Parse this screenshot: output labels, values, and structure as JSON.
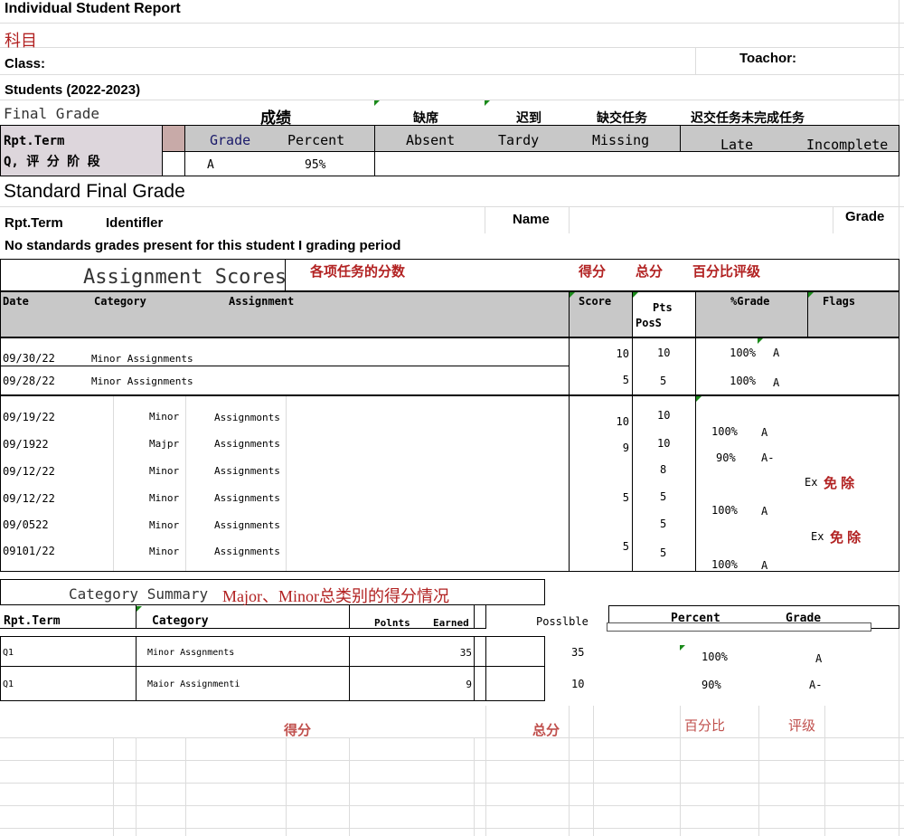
{
  "header": {
    "title": "Individual Student Report",
    "subject_cn": "科目",
    "class_label": "Class:",
    "teacher_label": "Toachor:",
    "students_label": "Students (2022-2023)"
  },
  "final_grade": {
    "label": "Final Grade",
    "label_cn": "成绩",
    "absent_cn": "缺席",
    "tardy_cn": "迟到",
    "missing_cn": "缺交任务",
    "late_incomplete_cn": "迟交任务未完成任务",
    "rpt_term": "Rpt.Term",
    "term_cn": "Q, 评 分 阶 段",
    "col_grade": "Grade",
    "col_percent": "Percent",
    "col_absent": "Absent",
    "col_tardy": "Tardy",
    "col_missing": "Missing",
    "col_late": "Late",
    "col_incomplete": "Incomplete",
    "val_grade": "A",
    "val_percent": "95%"
  },
  "standard": {
    "title": "Standard Final Grade",
    "rpt_term": "Rpt.Term",
    "identifier": "Identifler",
    "name": "Name",
    "grade": "Grade",
    "message": "No standards grades present for this student I grading period"
  },
  "assignments": {
    "title": "Assignment Scores",
    "title_cn": "各项任务的分数",
    "score_cn": "得分",
    "total_cn": "总分",
    "pct_cn": "百分比评级",
    "col_date": "Date",
    "col_category": "Category",
    "col_assignment": "Assignment",
    "col_score": "Score",
    "col_pts": "Pts",
    "col_poss": "PosS",
    "col_pct": "%Grade",
    "col_flags": "Flags",
    "group1": [
      {
        "date": "09/30/22",
        "category": "Minor Assignments",
        "score": "10",
        "pts": "10",
        "pct": "100%",
        "grade": "A"
      },
      {
        "date": "09/28/22",
        "category": "Minor Assignments",
        "score": "5",
        "pts": "5",
        "pct": "100%",
        "grade": "A"
      }
    ],
    "group2": [
      {
        "date": "09/19/22",
        "cat": "Minor",
        "assign": "Assignmonts",
        "score": "10",
        "pts": "10"
      },
      {
        "date": "09/1922",
        "cat": "Majpr",
        "assign": "Assignments",
        "score": "9",
        "pts": "10"
      },
      {
        "date": "09/12/22",
        "cat": "Minor",
        "assign": "Assignments",
        "score": "",
        "pts": "8"
      },
      {
        "date": "09/12/22",
        "cat": "Minor",
        "assign": "Assignments",
        "score": "5",
        "pts": "5"
      },
      {
        "date": "09/0522",
        "cat": "Minor",
        "assign": "Assignments",
        "score": "",
        "pts": "5"
      },
      {
        "date": "09101/22",
        "cat": "Minor",
        "assign": "Assignments",
        "score": "5",
        "pts": "5"
      }
    ],
    "group2_pct": [
      {
        "pct": "100%",
        "grade": "A"
      },
      {
        "pct": "90%",
        "grade": "A-"
      },
      {
        "pct": "100%",
        "grade": "A"
      },
      {
        "pct": "100%",
        "grade": "A"
      }
    ],
    "ex_label": "Ex",
    "exempt_cn": "免 除"
  },
  "summary": {
    "title": "Category Summary",
    "title_cn": "Major、Minor总类别的得分情况",
    "col_rpt": "Rpt.Term",
    "col_category": "Category",
    "col_points": "Polnts",
    "col_earned": "Earned",
    "col_possible": "Posslble",
    "col_percent": "Percent",
    "col_grade": "Grade",
    "rows": [
      {
        "term": "Q1",
        "category": "Minor Assgnments",
        "earned": "35",
        "possible": "35",
        "percent": "100%",
        "grade": "A"
      },
      {
        "term": "Q1",
        "category": "Maior Assignmenti",
        "earned": "9",
        "possible": "10",
        "percent": "90%",
        "grade": "A-"
      }
    ],
    "score_cn": "得分",
    "total_cn": "总分",
    "pct_cn": "百分比",
    "grade_cn": "评级"
  }
}
